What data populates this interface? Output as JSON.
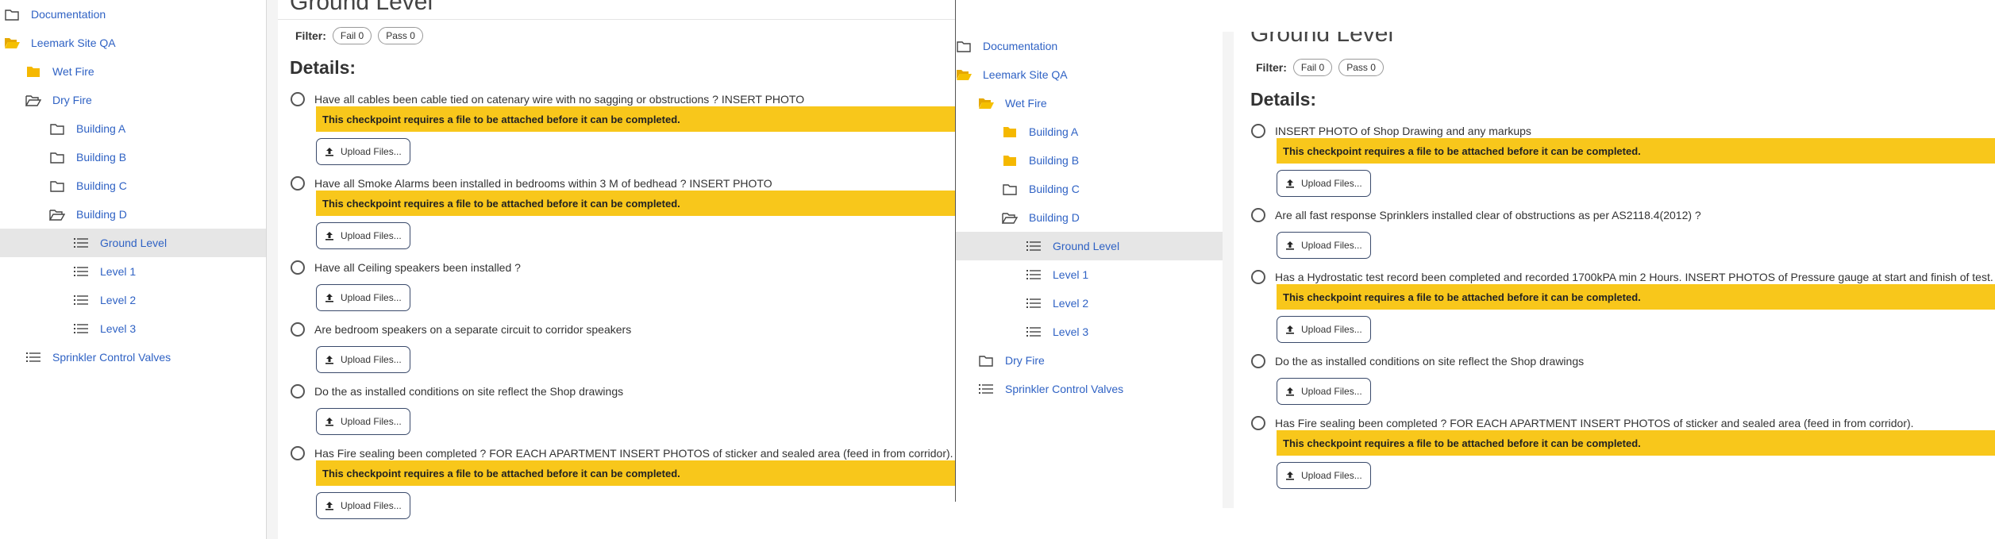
{
  "colors": {
    "link": "#2f62c4",
    "warning": "#f8c71b",
    "selected_bg": "#e6e6e6",
    "folder_yellow": "#f5b800"
  },
  "left": {
    "tree": [
      {
        "label": "Documentation",
        "icon": "folder-outline-icon"
      },
      {
        "label": "Leemark Site QA",
        "icon": "folder-open-icon"
      },
      {
        "label": "Wet Fire",
        "icon": "folder-filled-icon"
      },
      {
        "label": "Dry Fire",
        "icon": "folder-open-outline-icon"
      },
      {
        "label": "Building A",
        "icon": "folder-outline-icon"
      },
      {
        "label": "Building B",
        "icon": "folder-outline-icon"
      },
      {
        "label": "Building C",
        "icon": "folder-outline-icon"
      },
      {
        "label": "Building D",
        "icon": "folder-open-outline-icon"
      },
      {
        "label": "Ground Level",
        "icon": "list-icon",
        "selected": true
      },
      {
        "label": "Level 1",
        "icon": "list-icon"
      },
      {
        "label": "Level 2",
        "icon": "list-icon"
      },
      {
        "label": "Level 3",
        "icon": "list-icon"
      },
      {
        "label": "Sprinkler Control Valves",
        "icon": "list-icon"
      }
    ],
    "title": "Ground Level",
    "filter_label": "Filter:",
    "fail_pill": "Fail 0",
    "pass_pill": "Pass 0",
    "details_heading": "Details:",
    "warning_text": "This checkpoint requires a file to be attached before it can be completed.",
    "upload_label": "Upload Files...",
    "checkpoints": [
      {
        "text": "Have all cables been cable tied on catenary wire with no sagging or obstructions ? INSERT PHOTO",
        "requires_file": true
      },
      {
        "text": "Have all Smoke Alarms been installed in bedrooms within 3 M of bedhead ? INSERT PHOTO",
        "requires_file": true
      },
      {
        "text": "Have all Ceiling speakers been installed ?",
        "requires_file": false
      },
      {
        "text": "Are bedroom speakers on a separate circuit to corridor speakers",
        "requires_file": false
      },
      {
        "text": "Do the as installed conditions on site reflect the Shop drawings",
        "requires_file": false
      },
      {
        "text": "Has Fire sealing been completed ? FOR EACH APARTMENT INSERT PHOTOS of sticker and sealed area (feed in from corridor).",
        "requires_file": true
      }
    ]
  },
  "right": {
    "tree": [
      {
        "label": "Documentation",
        "icon": "folder-outline-icon"
      },
      {
        "label": "Leemark Site QA",
        "icon": "folder-open-icon"
      },
      {
        "label": "Wet Fire",
        "icon": "folder-open-icon"
      },
      {
        "label": "Building A",
        "icon": "folder-filled-icon"
      },
      {
        "label": "Building B",
        "icon": "folder-filled-icon"
      },
      {
        "label": "Building C",
        "icon": "folder-outline-icon"
      },
      {
        "label": "Building D",
        "icon": "folder-open-outline-icon"
      },
      {
        "label": "Ground Level",
        "icon": "list-icon",
        "selected": true
      },
      {
        "label": "Level 1",
        "icon": "list-icon"
      },
      {
        "label": "Level 2",
        "icon": "list-icon"
      },
      {
        "label": "Level 3",
        "icon": "list-icon"
      },
      {
        "label": "Dry Fire",
        "icon": "folder-outline-icon"
      },
      {
        "label": "Sprinkler Control Valves",
        "icon": "list-icon"
      }
    ],
    "title": "Ground Level",
    "filter_label": "Filter:",
    "fail_pill": "Fail 0",
    "pass_pill": "Pass 0",
    "details_heading": "Details:",
    "warning_text": "This checkpoint requires a file to be attached before it can be completed.",
    "upload_label": "Upload Files...",
    "checkpoints": [
      {
        "text": "INSERT PHOTO of Shop Drawing and any markups",
        "requires_file": true
      },
      {
        "text": "Are all fast response Sprinklers installed clear of obstructions as per AS2118.4(2012) ?",
        "requires_file": false
      },
      {
        "text": "Has a Hydrostatic test record been completed and recorded 1700kPA min 2 Hours. INSERT PHOTOS of Pressure gauge at start and finish of test.",
        "requires_file": true
      },
      {
        "text": "Do the as installed conditions on site reflect the Shop drawings",
        "requires_file": false
      },
      {
        "text": "Has Fire sealing been completed ? FOR EACH APARTMENT INSERT PHOTOS of sticker and sealed area (feed in from corridor).",
        "requires_file": true
      }
    ]
  }
}
